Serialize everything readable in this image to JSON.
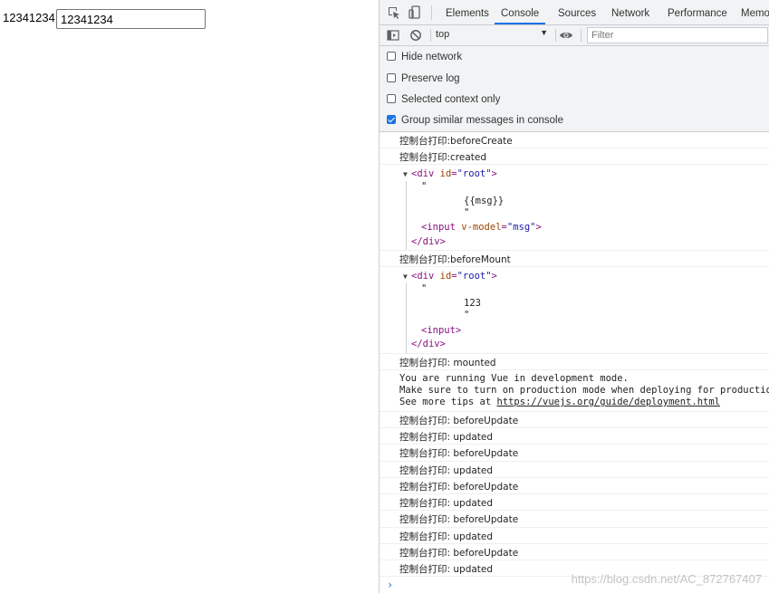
{
  "page": {
    "text": "12341234",
    "input_value": "12341234"
  },
  "devtools": {
    "tabs": [
      "Elements",
      "Console",
      "Sources",
      "Network",
      "Performance",
      "Memo"
    ],
    "active_tab": "Console",
    "context": "top",
    "filter_placeholder": "Filter",
    "options": [
      {
        "label": "Hide network",
        "checked": false
      },
      {
        "label": "Preserve log",
        "checked": false
      },
      {
        "label": "Selected context only",
        "checked": false
      },
      {
        "label": "Group similar messages in console",
        "checked": true
      }
    ],
    "icons": [
      "inspect-icon",
      "device-toggle-icon",
      "sidebar-toggle-icon",
      "clear-console-icon",
      "eye-icon"
    ]
  },
  "console": {
    "prefix": "控制台打印",
    "before_create": "控制台打印:beforeCreate",
    "created": "控制台打印:created",
    "tree1": {
      "open_tag_name": "div",
      "attr_name": "id",
      "attr_value": "\"root\"",
      "quote1": "\"",
      "content": "{{msg}}",
      "quote2": "\"",
      "child_tag": "input",
      "child_attr_name": "v-model",
      "child_attr_value": "\"msg\"",
      "close_tag": "</div>"
    },
    "before_mount": "控制台打印:beforeMount",
    "tree2": {
      "open_tag_name": "div",
      "attr_name": "id",
      "attr_value": "\"root\"",
      "quote1": "\"",
      "content": "123",
      "quote2": "\"",
      "child_tag": "<input>",
      "close_tag": "</div>"
    },
    "mounted": "控制台打印: mounted",
    "vue_msg_line1": "You are running Vue in development mode.",
    "vue_msg_line2": "Make sure to turn on production mode when deploying for production.",
    "vue_msg_line3_prefix": "See more tips at ",
    "vue_msg_link": "https://vuejs.org/guide/deployment.html",
    "updates": [
      "控制台打印: beforeUpdate",
      "控制台打印: updated",
      "控制台打印: beforeUpdate",
      "控制台打印: updated",
      "控制台打印: beforeUpdate",
      "控制台打印: updated",
      "控制台打印: beforeUpdate",
      "控制台打印: updated",
      "控制台打印: beforeUpdate",
      "控制台打印: updated"
    ],
    "prompt": "›",
    "watermark": "https://blog.csdn.net/AC_872767407"
  }
}
